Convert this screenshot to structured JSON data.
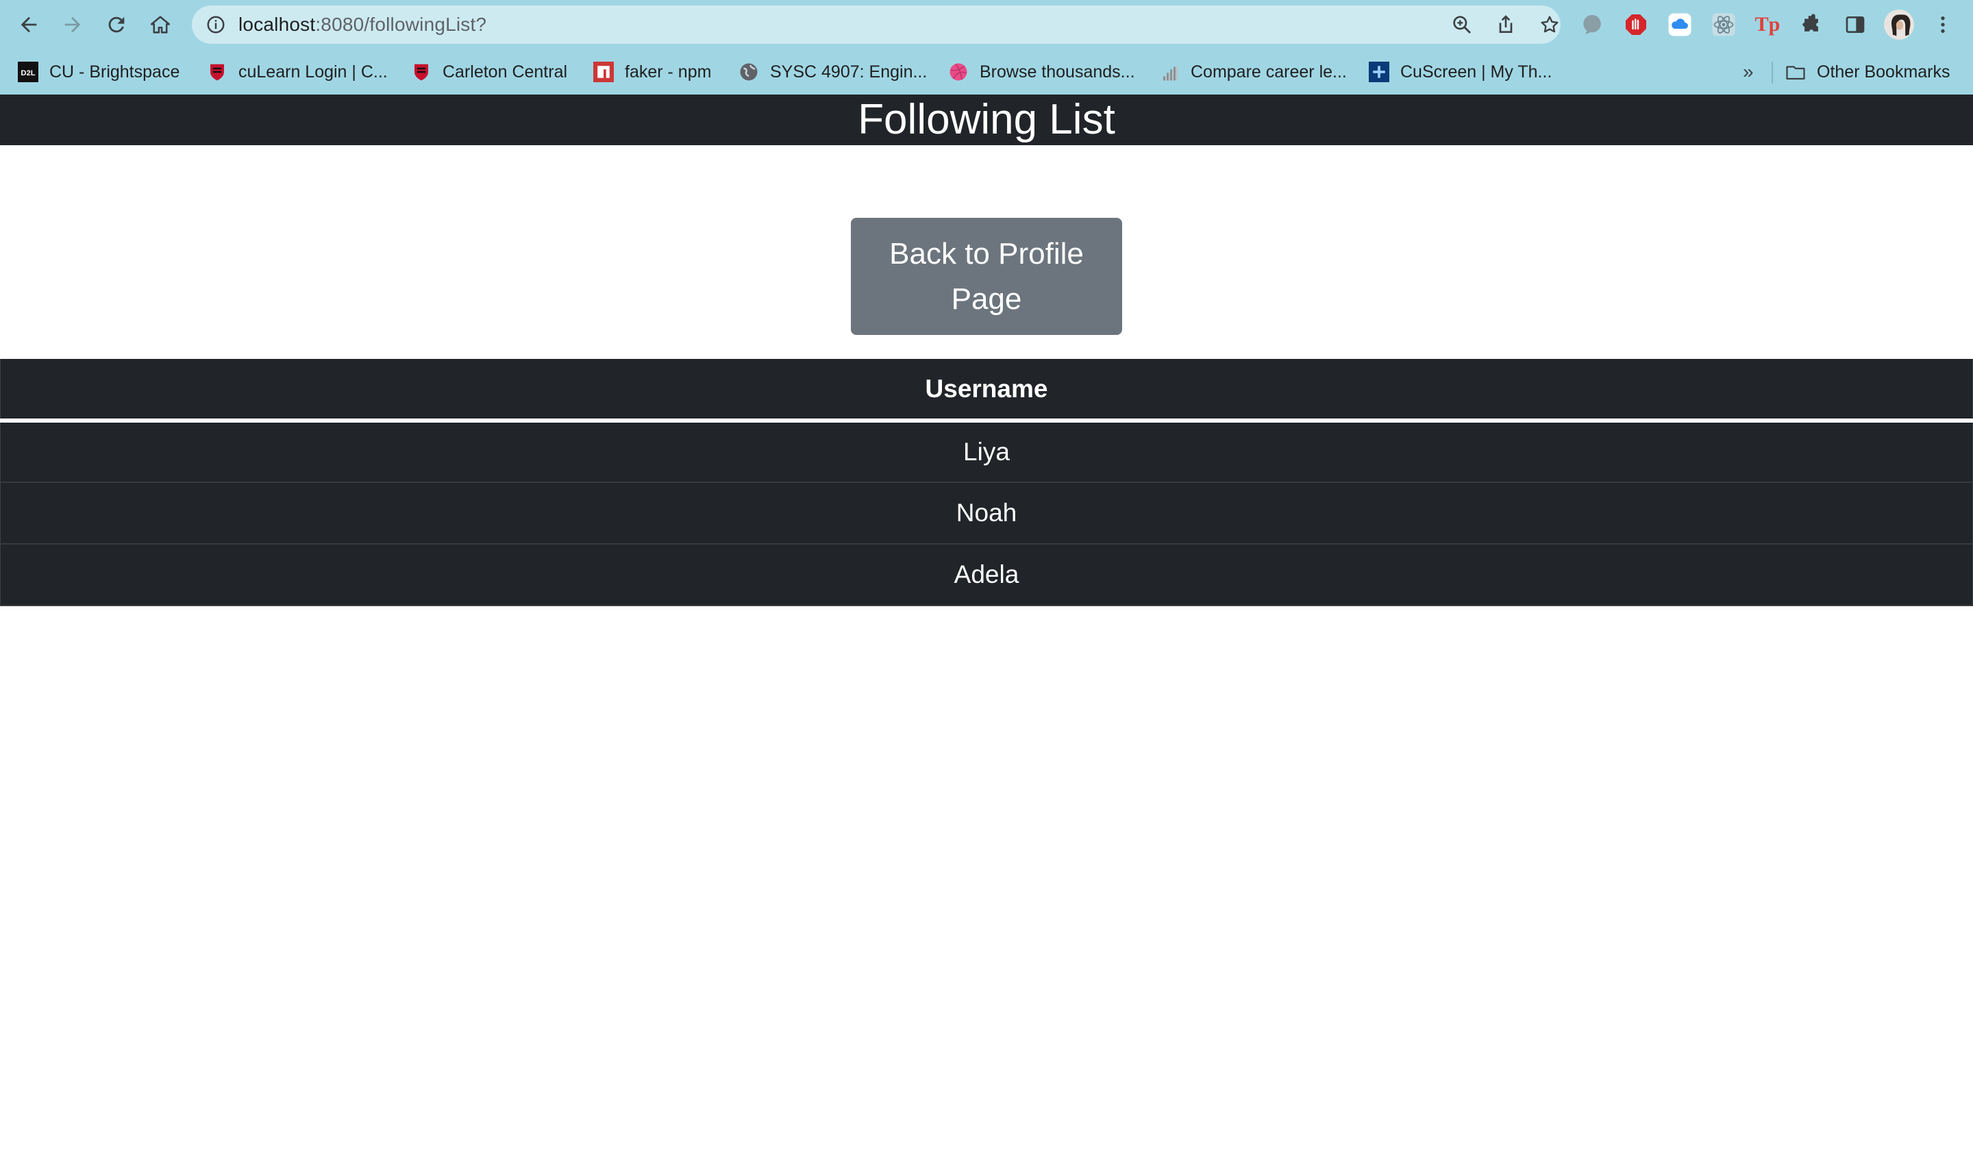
{
  "browser": {
    "url_host": "localhost",
    "url_path": ":8080/followingList?",
    "bookmarks": [
      {
        "label": "CU - Brightspace",
        "icon": "d2l-icon"
      },
      {
        "label": "cuLearn Login | C...",
        "icon": "carleton-icon"
      },
      {
        "label": "Carleton Central",
        "icon": "carleton-icon"
      },
      {
        "label": "faker - npm",
        "icon": "npm-icon"
      },
      {
        "label": "SYSC 4907: Engin...",
        "icon": "globe-icon"
      },
      {
        "label": "Browse thousands...",
        "icon": "dribbble-icon"
      },
      {
        "label": "Compare career le...",
        "icon": "levels-icon"
      },
      {
        "label": "CuScreen | My Th...",
        "icon": "cuscreen-icon"
      }
    ],
    "overflow_label": "»",
    "other_bookmarks": "Other Bookmarks"
  },
  "page": {
    "title": "Following List",
    "back_button": "Back to Profile Page",
    "table": {
      "header": "Username",
      "rows": [
        "Liya",
        "Noah",
        "Adela"
      ]
    }
  },
  "colors": {
    "chrome": "#a0d6e4",
    "header_bg": "#212529",
    "button_bg": "#6c757d"
  }
}
